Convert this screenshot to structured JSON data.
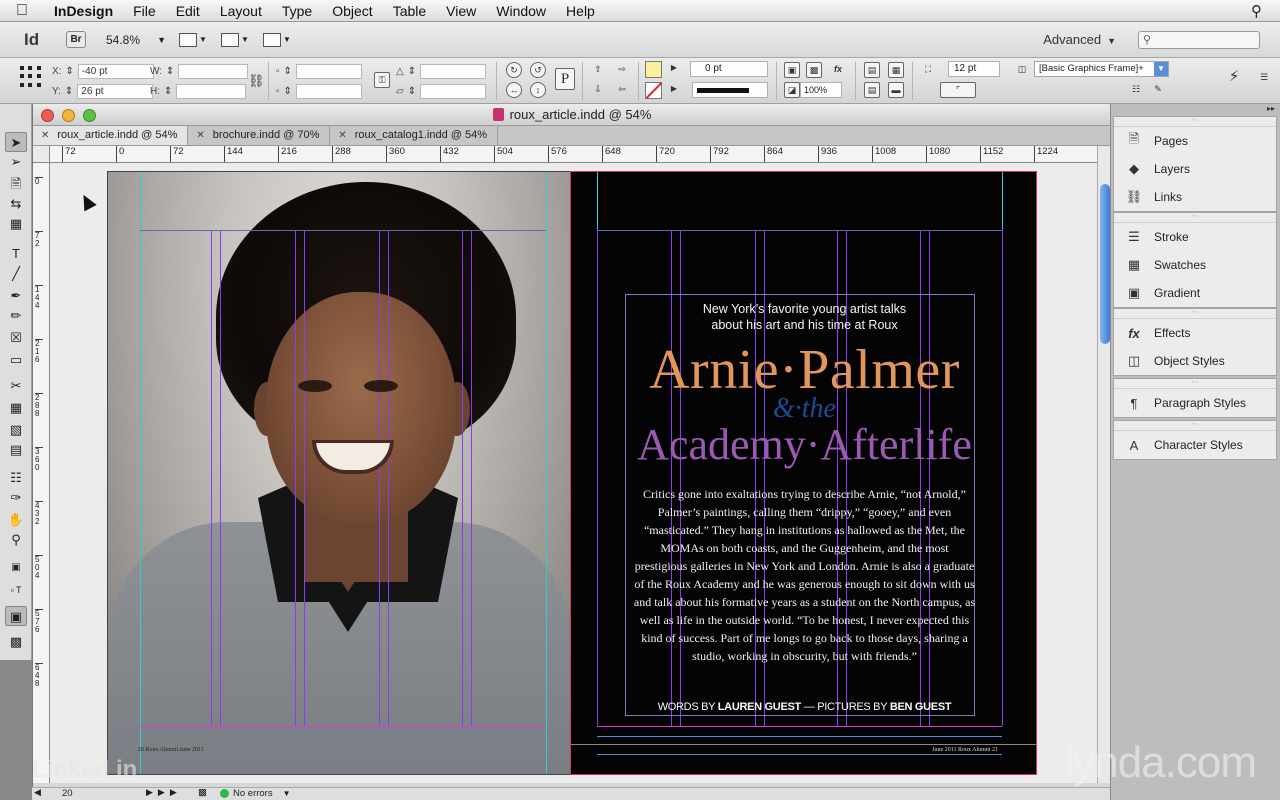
{
  "menubar": {
    "app": "InDesign",
    "items": [
      "File",
      "Edit",
      "Layout",
      "Type",
      "Object",
      "Table",
      "View",
      "Window",
      "Help"
    ]
  },
  "appbar": {
    "logo": "Id",
    "bridge": "Br",
    "zoom": "54.8%",
    "workspace": "Advanced"
  },
  "control": {
    "x_label": "X:",
    "x_value": "-40 pt",
    "y_label": "Y:",
    "y_value": "26 pt",
    "w_label": "W:",
    "h_label": "H:",
    "stroke_weight": "0 pt",
    "opacity": "100%",
    "gutter": "12 pt",
    "object_style": "[Basic Graphics Frame]+",
    "fill_color": "#fcf0a0"
  },
  "document": {
    "window_title": "roux_article.indd @ 54%",
    "tabs": [
      {
        "label": "roux_article.indd @ 54%",
        "active": true
      },
      {
        "label": "brochure.indd @ 70%",
        "active": false
      },
      {
        "label": "roux_catalog1.indd @ 54%",
        "active": false
      }
    ],
    "ruler_h": [
      "72",
      "0",
      "72",
      "144",
      "216",
      "288",
      "360",
      "432",
      "504",
      "576",
      "648",
      "720",
      "792",
      "864",
      "936",
      "1008",
      "1080",
      "1152",
      "1224"
    ],
    "ruler_v": [
      "0",
      "72",
      "144",
      "216",
      "288",
      "360",
      "432",
      "504",
      "576",
      "648"
    ]
  },
  "spread": {
    "left_folio": "20  Roux Alumni  June 2011",
    "right_folio": "June 2011  Roux Alumni  21",
    "deck_line1": "New York’s favorite young artist talks",
    "deck_line2": "about his art and his time at Roux",
    "headline1": "Arnie·Palmer",
    "headline2": "&·the",
    "headline3": "Academy·Afterlife",
    "body": "Critics gone into exaltations trying to describe Arnie, “not Arnold,” Palmer’s paintings, calling them “drippy,” “gooey,” and even “masticated.” They hang in institutions as hallowed as the Met, the MOMAs on both coasts, and the Guggenheim, and the most prestigious galleries in New York and London. Arnie is also a graduate of the Roux Academy and he was generous enough to sit down with us and talk about his formative years as a student on the North campus, as well as life in the outside world. “To be honest, I never expected this kind of success. Part of me longs to go back to those days, sharing a studio, working in obscurity, but with friends.”",
    "byline_words": "WORDS BY",
    "byline_author": "LAUREN GUEST",
    "byline_sep": "—",
    "byline_pics": "PICTURES BY",
    "byline_photographer": "BEN GUEST",
    "headline_colors": {
      "primary": "#e4965a",
      "secondary": "#1e4a96",
      "tertiary": "#9a5ab4"
    }
  },
  "status": {
    "page": "20",
    "preflight": "No errors"
  },
  "panels": {
    "group1": [
      {
        "label": "Pages",
        "icon": "pages-icon"
      },
      {
        "label": "Layers",
        "icon": "layers-icon"
      },
      {
        "label": "Links",
        "icon": "links-icon"
      }
    ],
    "group2": [
      {
        "label": "Stroke",
        "icon": "stroke-icon"
      },
      {
        "label": "Swatches",
        "icon": "swatches-icon"
      },
      {
        "label": "Gradient",
        "icon": "gradient-icon"
      }
    ],
    "group3": [
      {
        "label": "Effects",
        "icon": "effects-icon"
      },
      {
        "label": "Object Styles",
        "icon": "object-styles-icon"
      }
    ],
    "group4": [
      {
        "label": "Paragraph Styles",
        "icon": "paragraph-styles-icon"
      }
    ],
    "group5": [
      {
        "label": "Character Styles",
        "icon": "character-styles-icon"
      }
    ]
  },
  "watermarks": {
    "lynda": "lynda.com",
    "linkedin": "Linked in"
  }
}
